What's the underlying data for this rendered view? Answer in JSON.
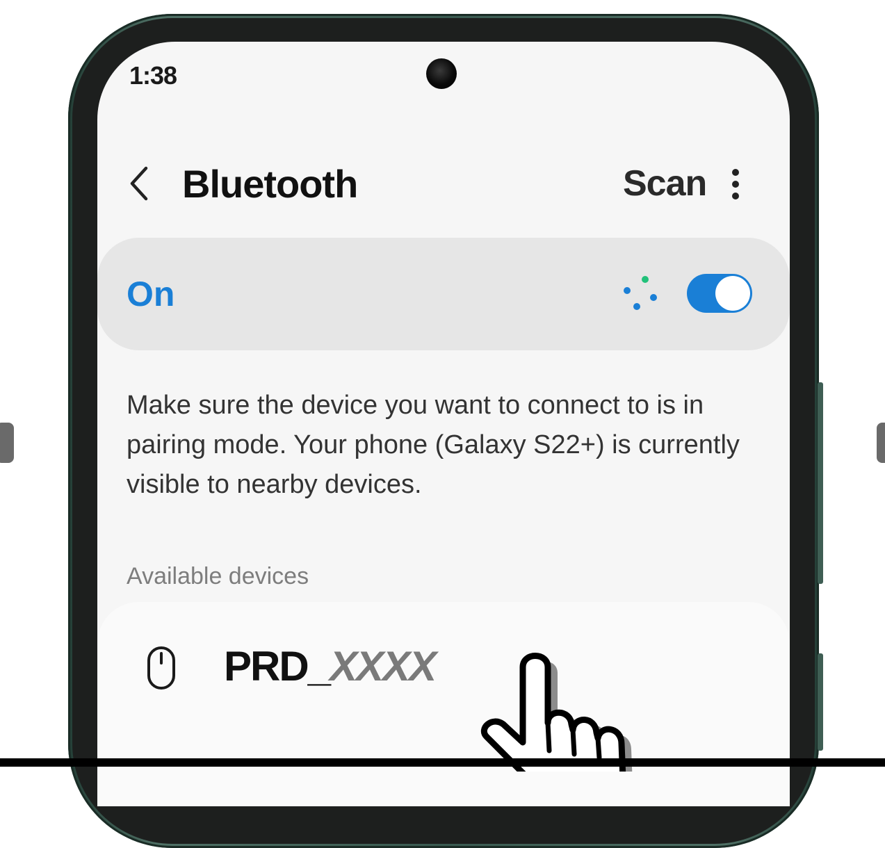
{
  "status_bar": {
    "time": "1:38"
  },
  "header": {
    "back_icon": "chevron-left-icon",
    "title": "Bluetooth",
    "scan_label": "Scan",
    "more_icon": "more-vert-icon"
  },
  "toggle": {
    "label": "On",
    "enabled": true,
    "scanning_icon": "scanning-dots-icon"
  },
  "info": {
    "text": "Make sure the device you want to connect to is in pairing mode. Your phone (Galaxy S22+) is currently visible to nearby devices."
  },
  "available_devices": {
    "header": "Available devices",
    "items": [
      {
        "icon": "mouse-icon",
        "name_prefix": "PRD_",
        "name_suffix": "XXXX"
      }
    ]
  },
  "colors": {
    "accent": "#1a7fd6",
    "scan_dot_green": "#22c17a",
    "screen_bg": "#f6f6f6",
    "toggle_row_bg": "#e6e6e6",
    "phone_frame": "#3a5a50"
  }
}
